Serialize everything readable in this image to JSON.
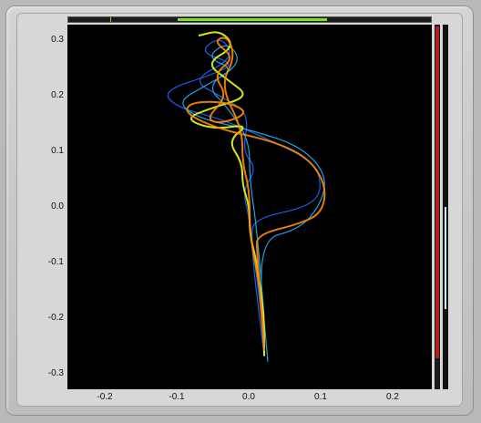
{
  "window": {
    "colors": {
      "frame": "#bdbdbd",
      "plot_bg": "#000000",
      "scroll_accent": "#7fe11e",
      "level_bar": "#b11f1f",
      "scroll_thumb": "#cfe8ff"
    }
  },
  "plot": {
    "y_ticks": [
      "0.3",
      "0.2",
      "0.1",
      "0.0",
      "-0.1",
      "-0.2",
      "-0.3"
    ],
    "x_ticks": [
      "-0.2",
      "-0.1",
      "0.0",
      "0.1",
      "0.2"
    ]
  },
  "chart_data": {
    "type": "line",
    "xlim": [
      -0.25,
      0.25
    ],
    "ylim": [
      -0.33,
      0.33
    ],
    "grid": false,
    "series": [
      {
        "color": "#1d6bff",
        "values": [
          [
            0.02,
            -0.27
          ],
          [
            0.0,
            -0.05
          ],
          [
            0.01,
            -0.02
          ],
          [
            0.08,
            -0.0
          ],
          [
            0.1,
            0.03
          ],
          [
            0.09,
            0.08
          ],
          [
            0.03,
            0.12
          ],
          [
            -0.04,
            0.16
          ],
          [
            -0.1,
            0.18
          ],
          [
            -0.12,
            0.21
          ],
          [
            -0.05,
            0.24
          ],
          [
            -0.02,
            0.26
          ],
          [
            -0.07,
            0.28
          ],
          [
            -0.04,
            0.31
          ],
          [
            -0.02,
            0.27
          ],
          [
            -0.08,
            0.23
          ],
          [
            -0.04,
            0.2
          ],
          [
            0.0,
            0.17
          ],
          [
            -0.01,
            0.1
          ],
          [
            0.01,
            0.07
          ],
          [
            -0.01,
            0.03
          ],
          [
            0.0,
            -0.02
          ],
          [
            0.02,
            -0.24
          ]
        ]
      },
      {
        "color": "#1eb7ff",
        "values": [
          [
            0.025,
            -0.28
          ],
          [
            0.01,
            -0.06
          ],
          [
            0.07,
            -0.04
          ],
          [
            0.1,
            0.01
          ],
          [
            0.105,
            0.06
          ],
          [
            0.07,
            0.11
          ],
          [
            0.0,
            0.14
          ],
          [
            -0.07,
            0.16
          ],
          [
            -0.1,
            0.19
          ],
          [
            -0.06,
            0.22
          ],
          [
            -0.02,
            0.25
          ],
          [
            -0.06,
            0.27
          ],
          [
            -0.03,
            0.3
          ],
          [
            -0.01,
            0.26
          ],
          [
            -0.06,
            0.22
          ],
          [
            -0.03,
            0.18
          ],
          [
            0.0,
            0.12
          ],
          [
            0.0,
            0.05
          ],
          [
            0.01,
            -0.04
          ],
          [
            0.02,
            -0.2
          ]
        ]
      },
      {
        "color": "#e8ff1a",
        "values": [
          [
            -0.07,
            0.31
          ],
          [
            -0.04,
            0.32
          ],
          [
            -0.02,
            0.29
          ],
          [
            -0.06,
            0.26
          ],
          [
            -0.03,
            0.23
          ],
          [
            0.0,
            0.2
          ],
          [
            -0.05,
            0.18
          ],
          [
            -0.09,
            0.16
          ],
          [
            -0.05,
            0.14
          ],
          [
            0.0,
            0.15
          ],
          [
            -0.03,
            0.12
          ],
          [
            -0.01,
            0.08
          ],
          [
            -0.01,
            0.04
          ],
          [
            0.0,
            0.0
          ],
          [
            0.0,
            -0.05
          ],
          [
            0.01,
            -0.1
          ],
          [
            0.02,
            -0.2
          ],
          [
            0.02,
            -0.27
          ]
        ]
      },
      {
        "color": "#ff8a00",
        "values": [
          [
            0.02,
            -0.26
          ],
          [
            0.01,
            -0.08
          ],
          [
            0.01,
            -0.05
          ],
          [
            0.07,
            -0.03
          ],
          [
            0.1,
            -0.01
          ],
          [
            0.105,
            0.04
          ],
          [
            0.08,
            0.09
          ],
          [
            0.03,
            0.12
          ],
          [
            -0.04,
            0.14
          ],
          [
            -0.09,
            0.17
          ],
          [
            -0.08,
            0.19
          ],
          [
            -0.03,
            0.19
          ],
          [
            0.0,
            0.17
          ],
          [
            -0.04,
            0.15
          ],
          [
            -0.06,
            0.16
          ],
          [
            -0.03,
            0.2
          ],
          [
            -0.05,
            0.24
          ],
          [
            -0.02,
            0.27
          ],
          [
            -0.05,
            0.3
          ],
          [
            -0.03,
            0.31
          ],
          [
            -0.02,
            0.27
          ],
          [
            -0.04,
            0.22
          ],
          [
            -0.01,
            0.14
          ],
          [
            -0.01,
            0.08
          ],
          [
            0.0,
            0.03
          ],
          [
            0.0,
            -0.05
          ],
          [
            0.015,
            -0.15
          ],
          [
            0.02,
            -0.25
          ]
        ]
      }
    ]
  }
}
